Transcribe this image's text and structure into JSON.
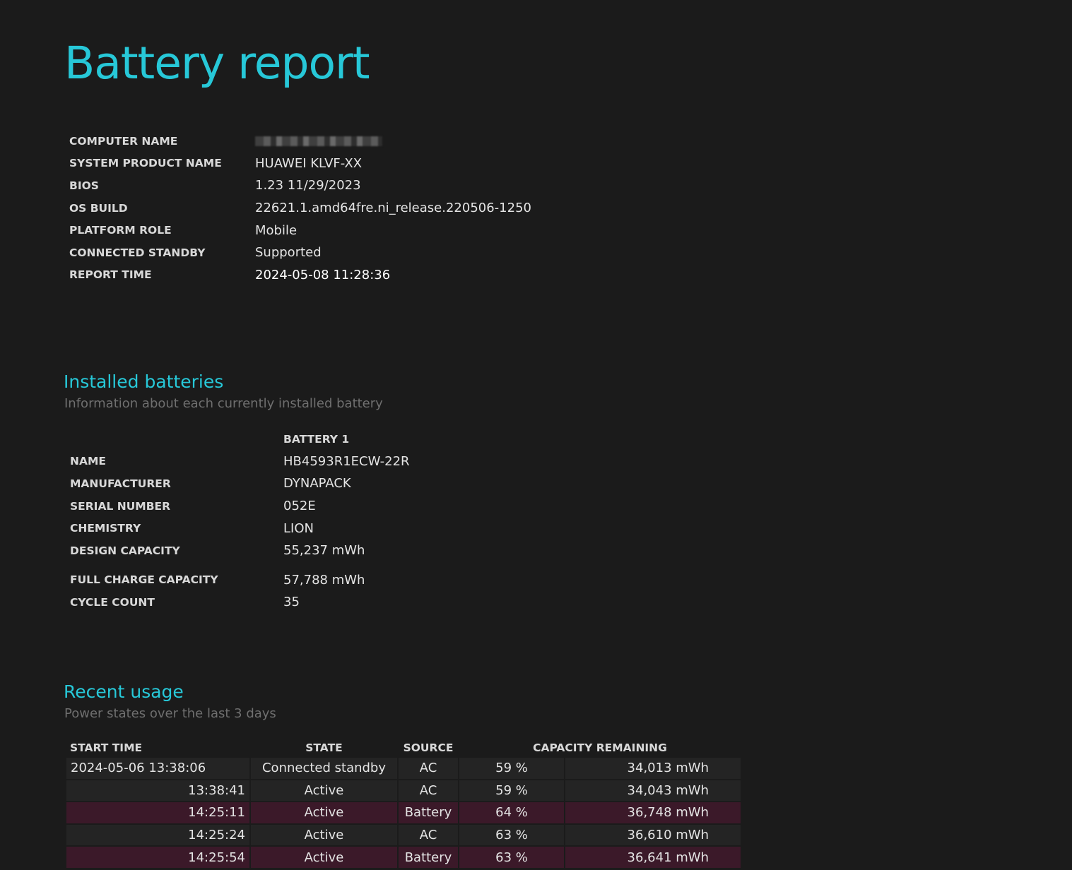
{
  "title": "Battery report",
  "info": {
    "rows": [
      {
        "label": "COMPUTER NAME",
        "value": ""
      },
      {
        "label": "SYSTEM PRODUCT NAME",
        "value": "HUAWEI KLVF-XX"
      },
      {
        "label": "BIOS",
        "value": "1.23 11/29/2023"
      },
      {
        "label": "OS BUILD",
        "value": "22621.1.amd64fre.ni_release.220506-1250"
      },
      {
        "label": "PLATFORM ROLE",
        "value": "Mobile"
      },
      {
        "label": "CONNECTED STANDBY",
        "value": "Supported"
      },
      {
        "label": "REPORT TIME",
        "value": "2024-05-08  11:28:36"
      }
    ]
  },
  "installed_batteries": {
    "heading": "Installed batteries",
    "subtitle": "Information about each currently installed battery",
    "column_header": "BATTERY 1",
    "rows": [
      {
        "label": "NAME",
        "value": "HB4593R1ECW-22R"
      },
      {
        "label": "MANUFACTURER",
        "value": "DYNAPACK"
      },
      {
        "label": "SERIAL NUMBER",
        "value": "052E"
      },
      {
        "label": "CHEMISTRY",
        "value": "LION"
      },
      {
        "label": "DESIGN CAPACITY",
        "value": "55,237 mWh"
      },
      {
        "label": "FULL CHARGE CAPACITY",
        "value": "57,788 mWh"
      },
      {
        "label": "CYCLE COUNT",
        "value": "35"
      }
    ]
  },
  "recent_usage": {
    "heading": "Recent usage",
    "subtitle": "Power states over the last 3 days",
    "columns": {
      "start_time": "START TIME",
      "state": "STATE",
      "source": "SOURCE",
      "capacity": "CAPACITY REMAINING"
    },
    "rows": [
      {
        "time": "2024-05-06  13:38:06",
        "state": "Connected standby",
        "source": "AC",
        "percent": "59 %",
        "mwh": "34,013 mWh",
        "on_battery": false
      },
      {
        "time": "13:38:41",
        "state": "Active",
        "source": "AC",
        "percent": "59 %",
        "mwh": "34,043 mWh",
        "on_battery": false
      },
      {
        "time": "14:25:11",
        "state": "Active",
        "source": "Battery",
        "percent": "64 %",
        "mwh": "36,748 mWh",
        "on_battery": true
      },
      {
        "time": "14:25:24",
        "state": "Active",
        "source": "AC",
        "percent": "63 %",
        "mwh": "36,610 mWh",
        "on_battery": false
      },
      {
        "time": "14:25:54",
        "state": "Active",
        "source": "Battery",
        "percent": "63 %",
        "mwh": "36,641 mWh",
        "on_battery": true
      }
    ]
  },
  "colors": {
    "background": "#1b1b1b",
    "accent": "#27c8d8",
    "battery_row": "#3b1929",
    "row": "#242424"
  }
}
